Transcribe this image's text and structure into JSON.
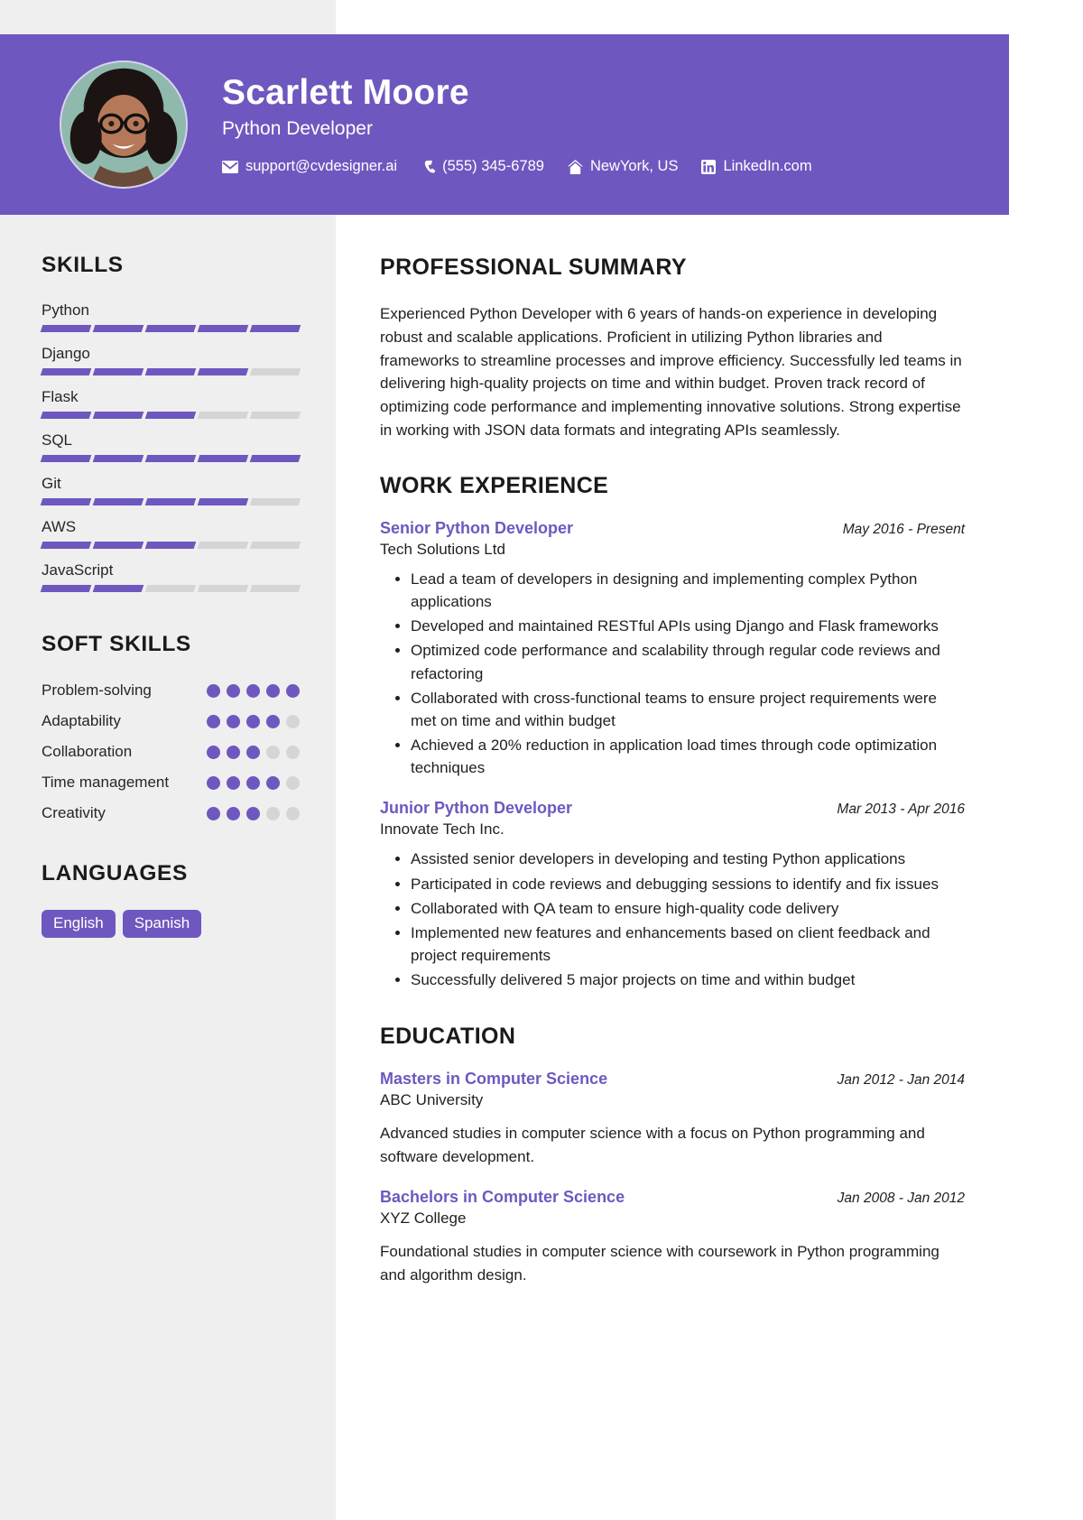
{
  "header": {
    "name": "Scarlett Moore",
    "role": "Python Developer",
    "accent_color": "#6e58bf",
    "contacts": [
      {
        "icon": "envelope-icon",
        "label": "support@cvdesigner.ai"
      },
      {
        "icon": "phone-icon",
        "label": "(555) 345-6789"
      },
      {
        "icon": "home-icon",
        "label": "NewYork, US"
      },
      {
        "icon": "linkedin-icon",
        "label": "LinkedIn.com"
      }
    ]
  },
  "sidebar": {
    "skills_title": "SKILLS",
    "skills": [
      {
        "name": "Python",
        "level": 5,
        "max": 5
      },
      {
        "name": "Django",
        "level": 4,
        "max": 5
      },
      {
        "name": "Flask",
        "level": 3,
        "max": 5
      },
      {
        "name": "SQL",
        "level": 5,
        "max": 5
      },
      {
        "name": "Git",
        "level": 4,
        "max": 5
      },
      {
        "name": "AWS",
        "level": 3,
        "max": 5
      },
      {
        "name": "JavaScript",
        "level": 2,
        "max": 5
      }
    ],
    "soft_skills_title": "SOFT SKILLS",
    "soft_skills": [
      {
        "name": "Problem-solving",
        "level": 5,
        "max": 5
      },
      {
        "name": "Adaptability",
        "level": 4,
        "max": 5
      },
      {
        "name": "Collaboration",
        "level": 3,
        "max": 5
      },
      {
        "name": "Time management",
        "level": 4,
        "max": 5
      },
      {
        "name": "Creativity",
        "level": 3,
        "max": 5
      }
    ],
    "languages_title": "LANGUAGES",
    "languages": [
      "English",
      "Spanish"
    ]
  },
  "main": {
    "summary_title": "PROFESSIONAL SUMMARY",
    "summary_text": "Experienced Python Developer with 6 years of hands-on experience in developing robust and scalable applications. Proficient in utilizing Python libraries and frameworks to streamline processes and improve efficiency. Successfully led teams in delivering high-quality projects on time and within budget. Proven track record of optimizing code performance and implementing innovative solutions. Strong expertise in working with JSON data formats and integrating APIs seamlessly.",
    "work_title": "WORK EXPERIENCE",
    "work": [
      {
        "title": "Senior Python Developer",
        "date": "May 2016 - Present",
        "org": "Tech Solutions Ltd",
        "bullets": [
          "Lead a team of developers in designing and implementing complex Python applications",
          "Developed and maintained RESTful APIs using Django and Flask frameworks",
          "Optimized code performance and scalability through regular code reviews and refactoring",
          "Collaborated with cross-functional teams to ensure project requirements were met on time and within budget",
          "Achieved a 20% reduction in application load times through code optimization techniques"
        ]
      },
      {
        "title": "Junior Python Developer",
        "date": "Mar 2013 - Apr 2016",
        "org": "Innovate Tech Inc.",
        "bullets": [
          "Assisted senior developers in developing and testing Python applications",
          "Participated in code reviews and debugging sessions to identify and fix issues",
          "Collaborated with QA team to ensure high-quality code delivery",
          "Implemented new features and enhancements based on client feedback and project requirements",
          "Successfully delivered 5 major projects on time and within budget"
        ]
      }
    ],
    "education_title": "EDUCATION",
    "education": [
      {
        "title": "Masters in Computer Science",
        "date": "Jan 2012 - Jan 2014",
        "org": "ABC University",
        "desc": "Advanced studies in computer science with a focus on Python programming and software development."
      },
      {
        "title": "Bachelors in Computer Science",
        "date": "Jan 2008 - Jan 2012",
        "org": "XYZ College",
        "desc": "Foundational studies in computer science with coursework in Python programming and algorithm design."
      }
    ]
  }
}
